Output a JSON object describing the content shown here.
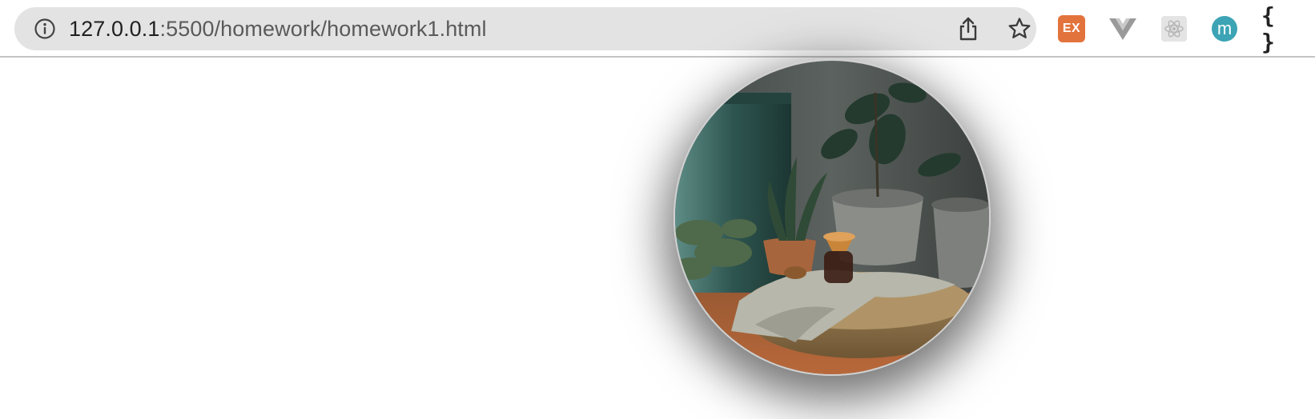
{
  "browser": {
    "url_host": "127.0.0.1",
    "url_rest": ":5500/homework/homework1.html",
    "site_info_icon": "info-circle-icon",
    "share_icon": "share-icon",
    "bookmark_icon": "star-icon"
  },
  "extensions": {
    "ex_label": "EX",
    "ex_color": "#e3733c",
    "vue_icon": "vue-devtools-icon",
    "react_icon": "react-devtools-icon",
    "m_label": "m",
    "m_color": "#3ca4b4",
    "braces_label": "{ }"
  },
  "page": {
    "image_alt": "Potted plants on a wooden table with a woven pouf and a coffee carafe",
    "image_shape": "circle"
  }
}
